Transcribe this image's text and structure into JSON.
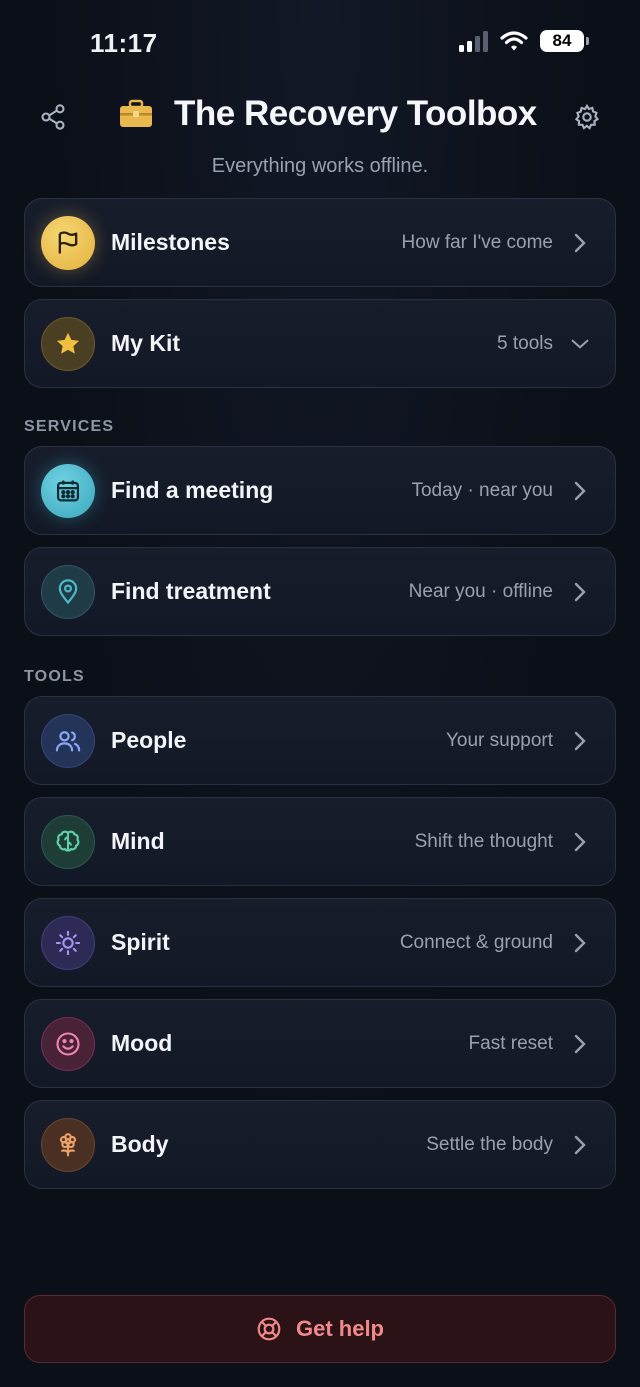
{
  "status": {
    "time": "11:17",
    "battery": "84"
  },
  "header": {
    "title": "The Recovery Toolbox",
    "subtitle": "Everything works offline."
  },
  "top_cards": [
    {
      "label": "Milestones",
      "hint": "How far I've come",
      "icon": "flag-icon"
    },
    {
      "label": "My Kit",
      "hint": "5 tools",
      "icon": "star-icon"
    }
  ],
  "services": {
    "heading": "SERVICES",
    "items": [
      {
        "label": "Find a meeting",
        "hint": "Today · near you",
        "icon": "calendar-icon"
      },
      {
        "label": "Find treatment",
        "hint": "Near you · offline",
        "icon": "map-pin-icon"
      }
    ]
  },
  "tools": {
    "heading": "TOOLS",
    "items": [
      {
        "label": "People",
        "hint": "Your support",
        "icon": "people-icon"
      },
      {
        "label": "Mind",
        "hint": "Shift the thought",
        "icon": "brain-icon"
      },
      {
        "label": "Spirit",
        "hint": "Connect & ground",
        "icon": "sun-icon"
      },
      {
        "label": "Mood",
        "hint": "Fast reset",
        "icon": "smile-icon"
      },
      {
        "label": "Body",
        "hint": "Settle the body",
        "icon": "flower-icon"
      }
    ]
  },
  "help": {
    "label": "Get help"
  },
  "colors": {
    "background": "#0b0f17",
    "milestones": "#f1c454",
    "kit": "#e9b740",
    "meeting": "#3fb3c9",
    "treatment": "#4aa8b8",
    "people": "#7d9cf0",
    "mind": "#4fc29a",
    "spirit": "#9b8cf0",
    "mood": "#e77fa9",
    "body": "#e59a5b",
    "help": "#f08a8a"
  }
}
